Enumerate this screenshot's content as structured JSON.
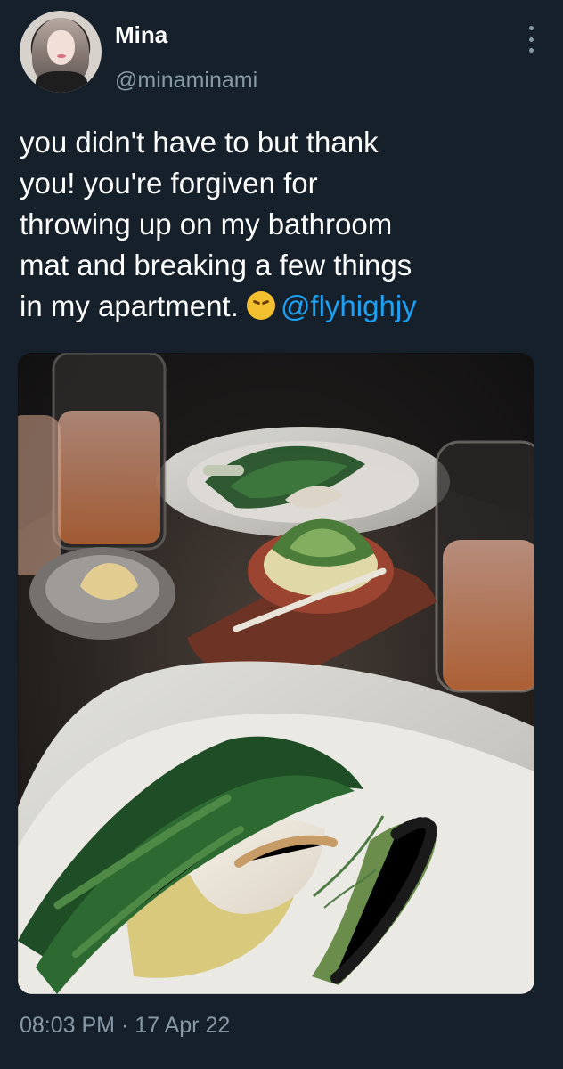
{
  "profile": {
    "name": "Mina",
    "handle": "@minaminami"
  },
  "tweet": {
    "text_before_emoji": "you didn't have to but thank\nyou! you're forgiven for\nthrowing up on my bathroom\nmat and breaking a few things\nin my apartment. ",
    "emoji": "persevering-face-emoji",
    "mention": "@flyhighjy",
    "timestamp": "08:03 PM · 17 Apr 22"
  },
  "photo": {
    "description_icon": "food-photo"
  }
}
